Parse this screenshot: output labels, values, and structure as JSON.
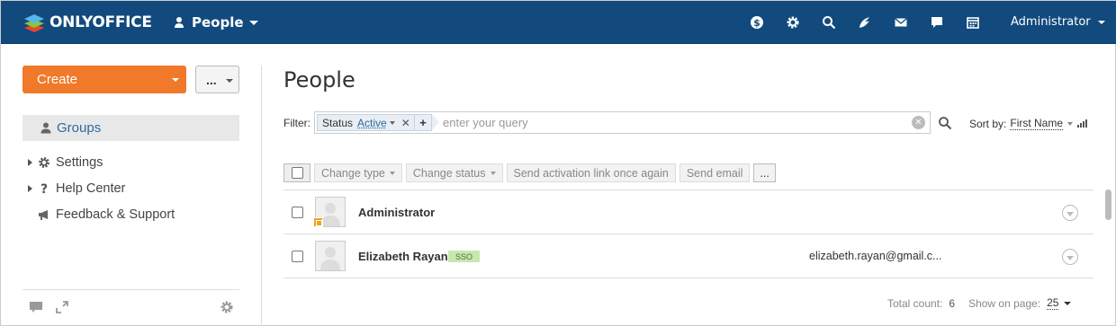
{
  "header": {
    "logo_text": "ONLYOFFICE",
    "module_name": "People",
    "icons": [
      "payments-icon",
      "settings-icon",
      "search-icon",
      "feed-icon",
      "mail-icon",
      "talk-icon",
      "calendar-icon"
    ],
    "user_name": "Administrator",
    "accent_color": "#124a7d"
  },
  "sidebar": {
    "create_label": "Create",
    "more_label": "...",
    "groups_label": "Groups",
    "items": [
      {
        "label": "Settings",
        "icon": "gear-icon"
      },
      {
        "label": "Help Center",
        "icon": "question-icon"
      },
      {
        "label": "Feedback & Support",
        "icon": "megaphone-icon"
      }
    ],
    "create_color": "#f0792a"
  },
  "main": {
    "title": "People",
    "filter": {
      "label": "Filter:",
      "chip_name": "Status",
      "chip_value": "Active",
      "placeholder": "enter your query"
    },
    "sort": {
      "label": "Sort by:",
      "value": "First Name"
    },
    "actions": [
      "Change type",
      "Change status",
      "Send activation link once again",
      "Send email",
      "..."
    ],
    "rows": [
      {
        "name": "Administrator",
        "badge": "",
        "email": "",
        "is_admin": true
      },
      {
        "name": "Elizabeth Rayan",
        "badge": "SSO",
        "email": "elizabeth.rayan@gmail.c...",
        "is_admin": false
      }
    ],
    "footer": {
      "total_label": "Total count:",
      "total_value": "6",
      "page_label": "Show on page:",
      "page_value": "25"
    }
  }
}
